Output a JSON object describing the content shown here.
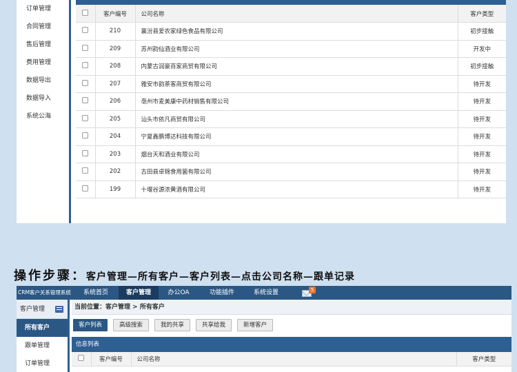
{
  "top_sidebar": {
    "items": [
      "订单管理",
      "合同管理",
      "售后管理",
      "费用管理",
      "数据导出",
      "数据导入",
      "系统公海"
    ]
  },
  "table": {
    "headers": {
      "id": "客户编号",
      "name": "公司名称",
      "type": "客户类型"
    },
    "rows": [
      {
        "id": "210",
        "name": "襄汾县爱农家绿色食品有限公司",
        "type": "初步接触"
      },
      {
        "id": "209",
        "name": "苏州韵仙酒业有限公司",
        "type": "开发中"
      },
      {
        "id": "208",
        "name": "内蒙古润豪百家商贸有限公司",
        "type": "初步接触"
      },
      {
        "id": "207",
        "name": "雅安市韵茶客商贸有限公司",
        "type": "待开发"
      },
      {
        "id": "206",
        "name": "亳州市麦美康中药材销售有限公司",
        "type": "待开发"
      },
      {
        "id": "205",
        "name": "汕头市依凡商贸有限公司",
        "type": "待开发"
      },
      {
        "id": "204",
        "name": "宁夏鑫鹏博达科技有限公司",
        "type": "待开发"
      },
      {
        "id": "203",
        "name": "烟台天和酒业有限公司",
        "type": "待开发"
      },
      {
        "id": "202",
        "name": "古田县卓锦食用菌有限公司",
        "type": "待开发"
      },
      {
        "id": "199",
        "name": "十堰谷源浓黄酒有限公司",
        "type": "待开发"
      }
    ]
  },
  "caption": {
    "lead": "操作步骤：",
    "steps": "客户管理—所有客户—客户列表—点击公司名称—跟单记录"
  },
  "app": {
    "brand": "CRM客户关系管理系统",
    "nav": [
      "系统首页",
      "客户管理",
      "办公OA",
      "功能插件",
      "系统设置"
    ],
    "active_nav": "客户管理",
    "mail_count": "5",
    "side_header": "客户管理",
    "side_items": [
      "所有客户",
      "跟单管理",
      "订单管理"
    ],
    "active_side": "所有客户",
    "breadcrumb": {
      "label": "当前位置：",
      "path": "客户管理 > 所有客户"
    },
    "buttons": [
      "客户列表",
      "高级搜索",
      "我的共享",
      "共享给我",
      "新增客户"
    ],
    "active_button": "客户列表",
    "info_title": "信息列表",
    "list_headers": {
      "id": "客户编号",
      "name": "公司名称",
      "type": "客户类型"
    }
  }
}
